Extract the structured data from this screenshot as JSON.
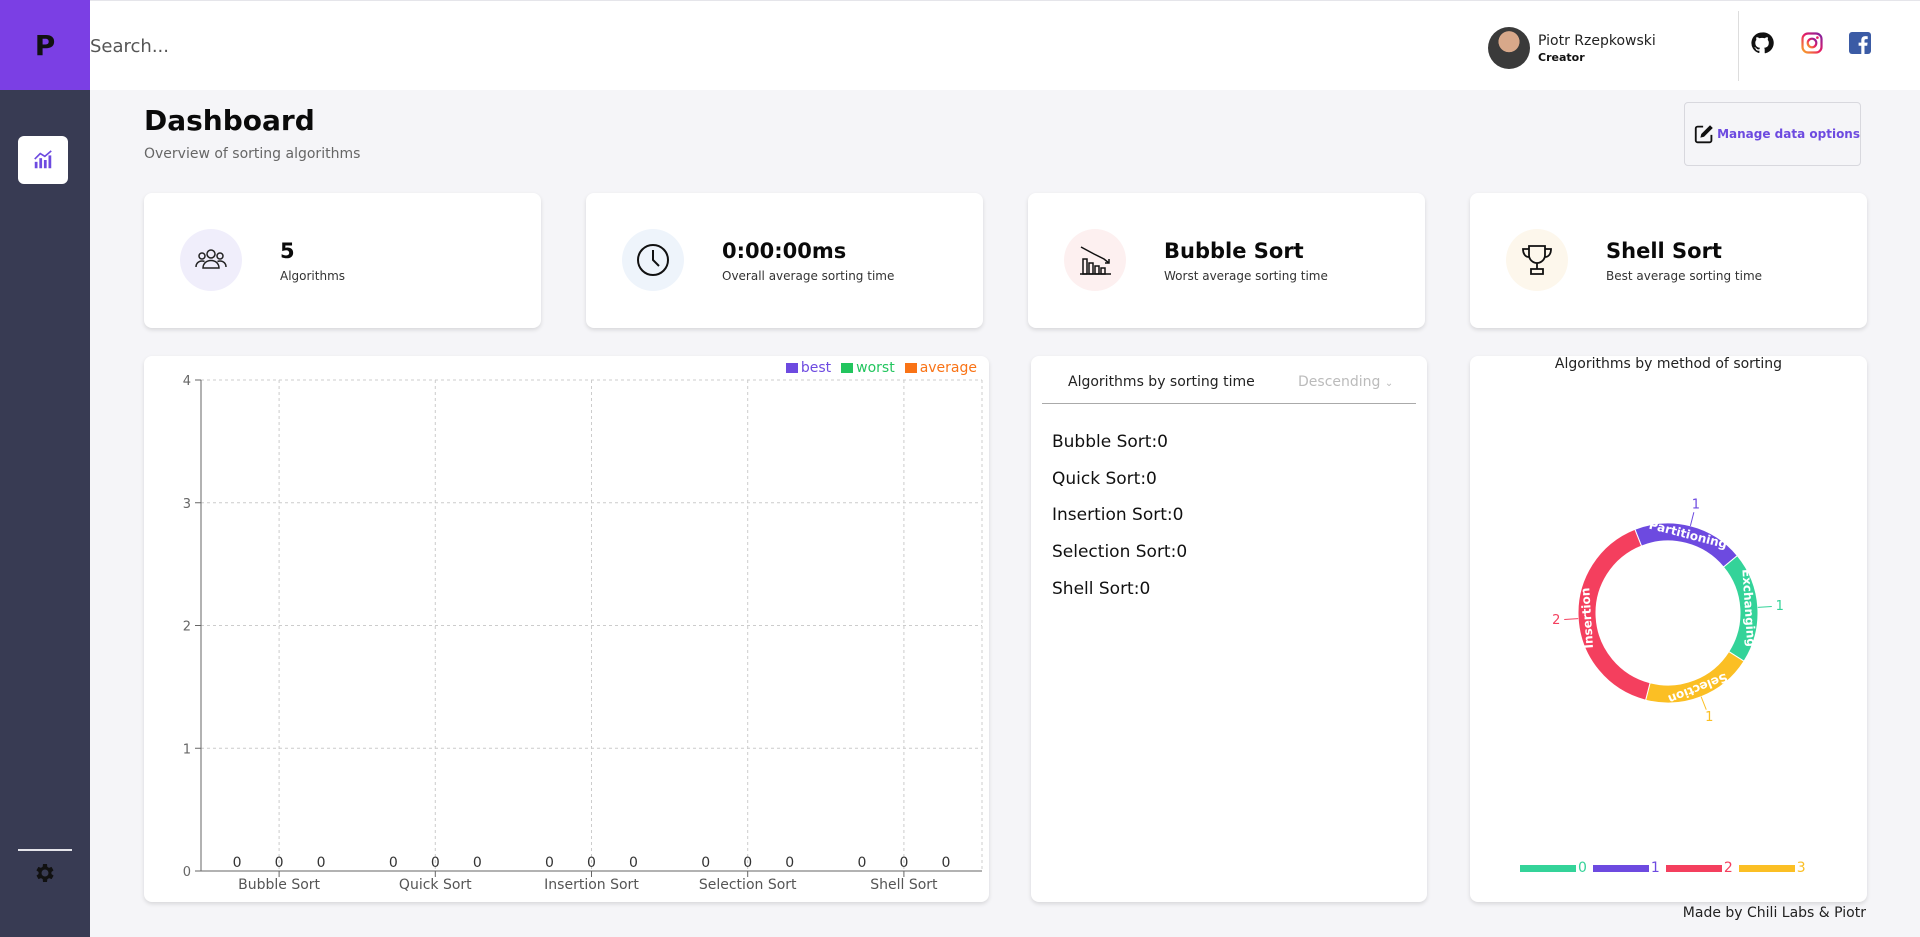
{
  "logo": {
    "letter": "P"
  },
  "header": {
    "search_placeholder": "Search...",
    "user": {
      "name": "Piotr Rzepkowski",
      "role": "Creator"
    },
    "social": [
      "github-icon",
      "instagram-icon",
      "facebook-icon"
    ]
  },
  "page": {
    "title": "Dashboard",
    "subtitle": "Overview of sorting algorithms",
    "manage_label": "Manage data options"
  },
  "stats": [
    {
      "value": "5",
      "label": "Algorithms",
      "icon": "users-icon",
      "icon_bg": "#f0eefb"
    },
    {
      "value": "0:00:00ms",
      "label": "Overall average sorting time",
      "icon": "clock-icon",
      "icon_bg": "#eef4fb"
    },
    {
      "value": "Bubble Sort",
      "label": "Worst average sorting time",
      "icon": "declining-chart-icon",
      "icon_bg": "#fdf0f0"
    },
    {
      "value": "Shell Sort",
      "label": "Best average sorting time",
      "icon": "trophy-icon",
      "icon_bg": "#fdf7ec"
    }
  ],
  "chart_data": [
    {
      "type": "bar",
      "categories": [
        "Bubble Sort",
        "Quick Sort",
        "Insertion Sort",
        "Selection Sort",
        "Shell Sort"
      ],
      "series": [
        {
          "name": "best",
          "color": "#6d4ae0",
          "values": [
            0,
            0,
            0,
            0,
            0
          ]
        },
        {
          "name": "worst",
          "color": "#22c55e",
          "values": [
            0,
            0,
            0,
            0,
            0
          ]
        },
        {
          "name": "average",
          "color": "#f97316",
          "values": [
            0,
            0,
            0,
            0,
            0
          ]
        }
      ],
      "ylim": [
        0,
        4
      ],
      "yticks": [
        "0",
        "1",
        "2",
        "3",
        "4"
      ],
      "grid": true,
      "legend": "top-right"
    },
    {
      "type": "pie",
      "title": "Algorithms by method of sorting",
      "slices": [
        {
          "label": "Partitioning",
          "value": 1,
          "color": "#6d4ae0"
        },
        {
          "label": "Exchanging",
          "value": 1,
          "color": "#34d399"
        },
        {
          "label": "Selection",
          "value": 1,
          "color": "#fbbf24"
        },
        {
          "label": "Insertion",
          "value": 2,
          "color": "#f43f5e"
        }
      ],
      "legend": [
        {
          "label": "0",
          "color": "#34d399"
        },
        {
          "label": "1",
          "color": "#6d4ae0"
        },
        {
          "label": "2",
          "color": "#f43f5e"
        },
        {
          "label": "3",
          "color": "#fbbf24"
        }
      ]
    }
  ],
  "list": {
    "title": "Algorithms by sorting time",
    "sort_label": "Descending",
    "items": [
      "Bubble Sort:0",
      "Quick Sort:0",
      "Insertion Sort:0",
      "Selection Sort:0",
      "Shell Sort:0"
    ]
  },
  "footer": "Made by Chili Labs & Piotr"
}
